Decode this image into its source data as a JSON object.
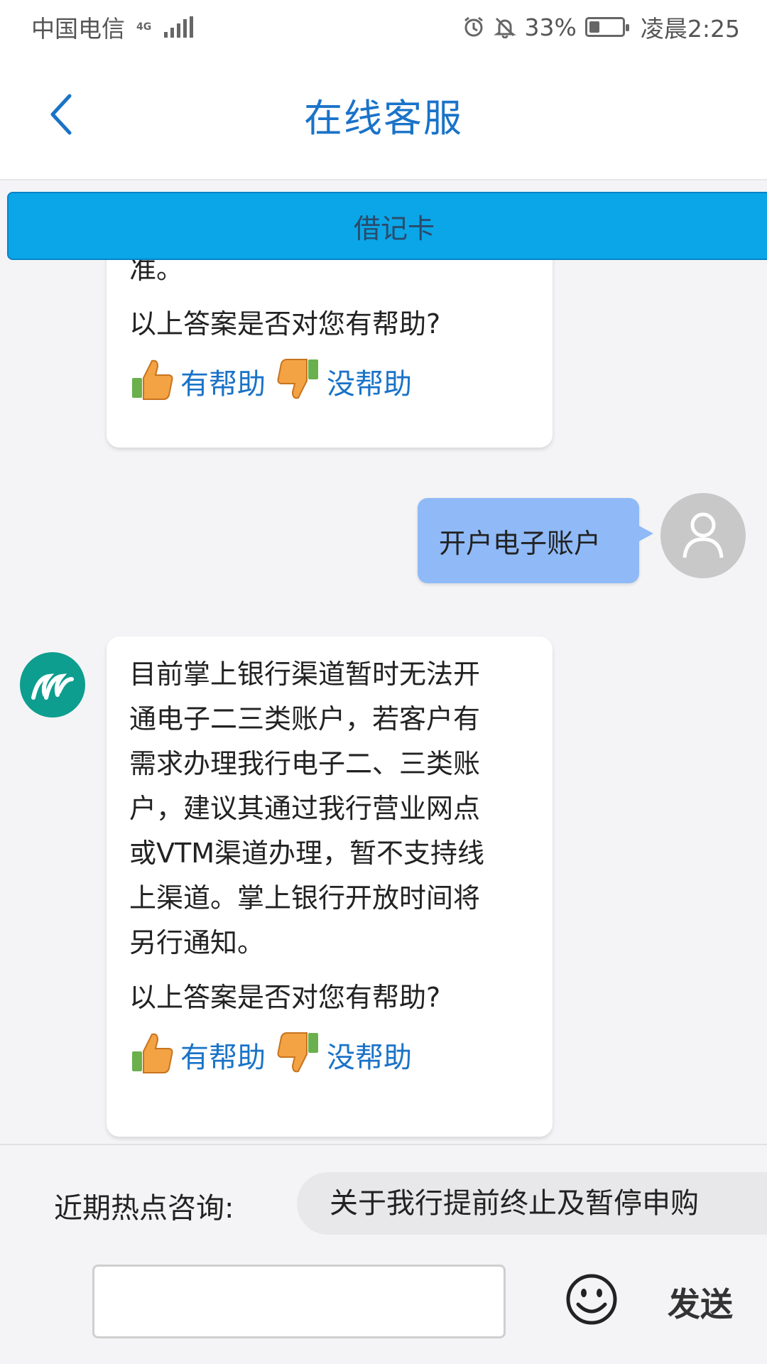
{
  "status_bar": {
    "carrier": "中国电信",
    "network": "4G",
    "battery_percent": "33%",
    "battery_level": 0.33,
    "time": "凌晨2:25"
  },
  "header": {
    "title": "在线客服"
  },
  "category_tab": {
    "label": "借记卡"
  },
  "messages": {
    "bot_1": {
      "answer_tail": "准。",
      "question": "以上答案是否对您有帮助?",
      "helpful_label": "有帮助",
      "not_helpful_label": "没帮助"
    },
    "user_1": {
      "text": "开户电子账户"
    },
    "bot_2": {
      "answer": "目前掌上银行渠道暂时无法开\n通电子二三类账户，若客户有\n需求办理我行电子二、三类账\n户，建议其通过我行营业网点\n或VTM渠道办理，暂不支持线\n上渠道。掌上银行开放时间将\n另行通知。",
      "question": "以上答案是否对您有帮助?",
      "helpful_label": "有帮助",
      "not_helpful_label": "没帮助"
    }
  },
  "hot_topics": {
    "label": "近期热点咨询:",
    "items": [
      "关于我行提前终止及暂停申购"
    ]
  },
  "input_bar": {
    "placeholder": "",
    "send_label": "发送"
  },
  "colors": {
    "accent": "#1a73c8",
    "tab_bg": "#0aa6e8",
    "user_bubble": "#8fbaf7",
    "bot_avatar": "#0d9e8f"
  }
}
